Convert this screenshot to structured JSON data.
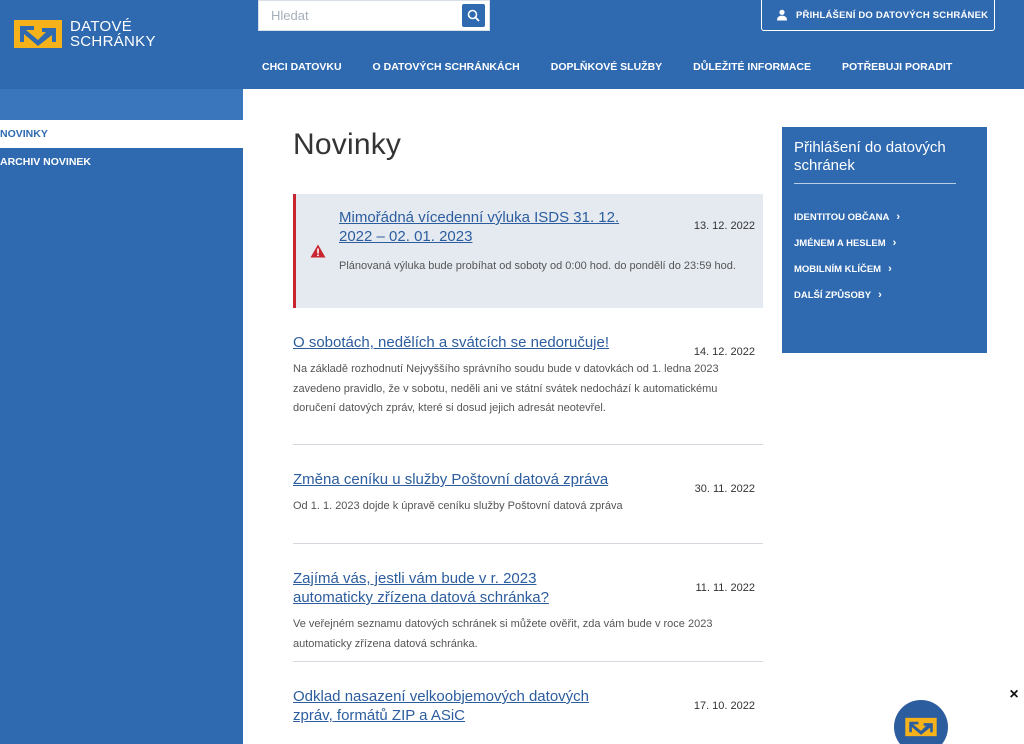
{
  "header": {
    "logo_line1": "DATOVÉ",
    "logo_line2": "SCHRÁNKY",
    "search_placeholder": "Hledat",
    "login_button": "PŘIHLÁŠENÍ DO DATOVÝCH SCHRÁNEK",
    "nav": [
      "CHCI DATOVKU",
      "O DATOVÝCH SCHRÁNKÁCH",
      "DOPLŇKOVÉ SLUŽBY",
      "DŮLEŽITÉ INFORMACE",
      "POTŘEBUJI PORADIT"
    ]
  },
  "sidebar": {
    "items": [
      {
        "label": "NOVINKY",
        "active": true
      },
      {
        "label": "ARCHIV NOVINEK",
        "active": false
      }
    ]
  },
  "main": {
    "title": "Novinky",
    "alert": {
      "title": "Mimořádná vícedenní výluka ISDS 31. 12. 2022 – 02. 01. 2023",
      "date": "13. 12. 2022",
      "text": "Plánovaná výluka bude probíhat od soboty od 0:00 hod. do pondělí do 23:59 hod."
    },
    "news": [
      {
        "title": "O sobotách, nedělích a svátcích se nedoručuje!",
        "date": "14. 12. 2022",
        "text": "Na základě rozhodnutí Nejvyššího správního soudu bude v datovkách od 1. ledna 2023 zavedeno pravidlo, že v sobotu, neděli ani ve státní svátek nedochází k automatickému doručení datových zpráv, které si dosud jejich adresát neotevřel."
      },
      {
        "title": "Změna ceníku u služby Poštovní datová zpráva",
        "date": "30. 11. 2022",
        "text": "Od 1. 1. 2023 dojde k úpravě ceníku služby Poštovní datová zpráva"
      },
      {
        "title": "Zajímá vás, jestli vám bude v r. 2023 automaticky zřízena datová schránka?",
        "date": "11. 11. 2022",
        "text": "Ve veřejném seznamu datových schránek si můžete ověřit, zda vám bude v roce 2023 automaticky zřízena datová schránka."
      },
      {
        "title": "Odklad nasazení velkoobjemových datových zpráv, formátů ZIP a ASiC",
        "date": "17. 10. 2022",
        "text": ""
      }
    ]
  },
  "login_box": {
    "title": "Přihlášení do datových schránek",
    "links": [
      "IDENTITOU OBČANA",
      "JMÉNEM A HESLEM",
      "MOBILNÍM KLÍČEM",
      "DALŠÍ ZPŮSOBY"
    ]
  },
  "close_label": "×",
  "colors": {
    "primary": "#2f6ab0",
    "accent": "#f5b21b",
    "alert": "#c8252f",
    "link": "#2c5d9e"
  }
}
